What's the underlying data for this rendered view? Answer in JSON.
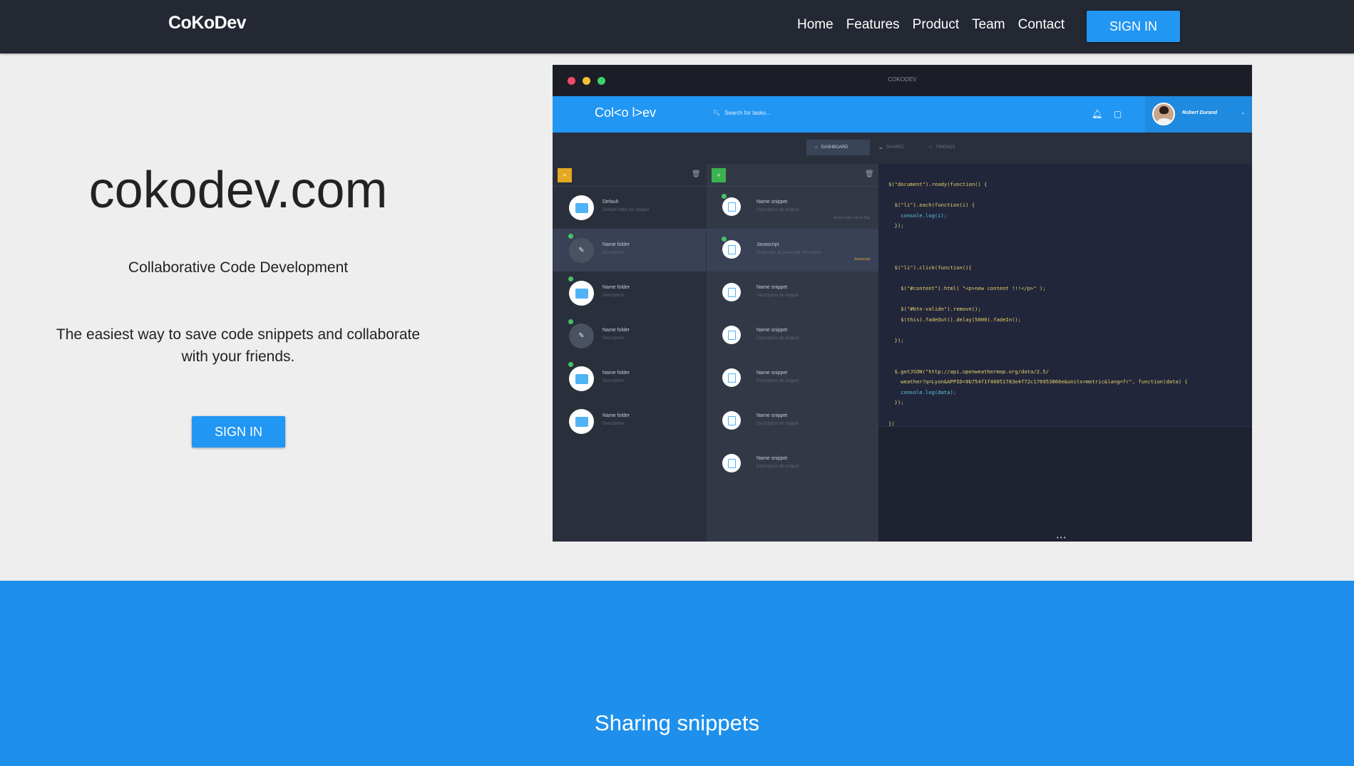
{
  "nav": {
    "brand": "CoKoDev",
    "items": [
      {
        "label": "Home"
      },
      {
        "label": "Features"
      },
      {
        "label": "Product"
      },
      {
        "label": "Team"
      },
      {
        "label": "Contact"
      }
    ],
    "signin_label": "SIGN IN"
  },
  "hero": {
    "title": "cokodev.com",
    "subtitle": "Collaborative Code Development",
    "description": "The easiest way to save code snippets and collaborate with your friends.",
    "signin_label": "SIGN IN"
  },
  "mockup": {
    "window_title": "COKODEV",
    "logo": "Col<o l>ev",
    "search_placeholder": "Search for tasks...",
    "user_name": "Robert Durand",
    "tabs": [
      "DASHBOARD",
      "SHARED",
      "FRIENDS"
    ],
    "folders": [
      {
        "name": "Default",
        "desc": "Default folder for snippet"
      },
      {
        "name": "Name folder",
        "desc": "Description"
      },
      {
        "name": "Name folder",
        "desc": "Description"
      },
      {
        "name": "Name folder",
        "desc": "Description"
      },
      {
        "name": "Name folder",
        "desc": "Description"
      },
      {
        "name": "Name folder",
        "desc": "Description"
      }
    ],
    "snippets": [
      {
        "name": "Name snippet",
        "desc": "Description de snippet",
        "tags": "Name folder    Name flag"
      },
      {
        "name": "Javascript",
        "desc": "Script ajax et javascript formulaire",
        "tags": "Javascript"
      },
      {
        "name": "Name snippet",
        "desc": "Description de snippet"
      },
      {
        "name": "Name snippet",
        "desc": "Description de snippet"
      },
      {
        "name": "Name snippet",
        "desc": "Description de snippet"
      },
      {
        "name": "Name snippet",
        "desc": "Description de snippet"
      },
      {
        "name": "Name snippet",
        "desc": "Description de snippet"
      }
    ],
    "code_lines": [
      "$(\"document\").ready(function() {",
      "",
      "  $(\"li\").each(function(i) {",
      "    console.log(i);",
      "  });",
      "",
      "",
      "",
      "  $(\"li\").click(function(){",
      "",
      "    $(\"#content\").html( \"<p>new content !!!</p>\" );",
      "",
      "    $(\"#btn-valide\").remove();",
      "    $(this).fadeOut().delay(5000).fadeIn();",
      "",
      "  });",
      "",
      "",
      "  $.getJSON(\"http://api.openweathermap.org/data/2.5/",
      "    weather?q=Lyon&APPID=9b754f1f40051783e4f72c176953866e&units=metric&lang=fr\", function(data) {",
      "    console.log(data);",
      "  });",
      "",
      "})"
    ]
  },
  "section": {
    "title": "Sharing snippets"
  },
  "colors": {
    "nav_bg": "#232833",
    "accent": "#2196f3",
    "section_bg": "#1e90ec"
  }
}
